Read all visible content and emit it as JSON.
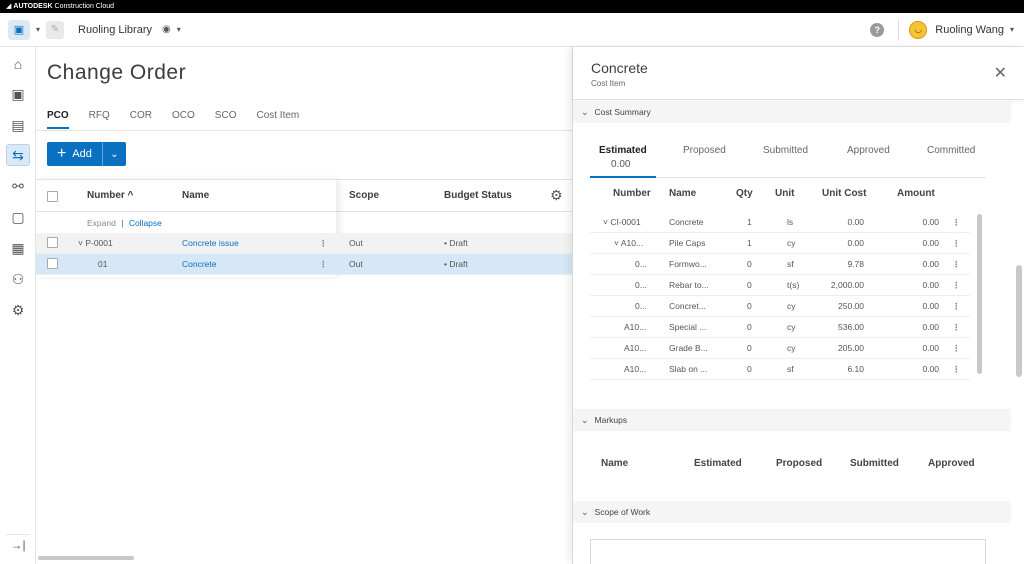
{
  "topbar": {
    "logo_mark": "◢",
    "brand": "AUTODESK",
    "product": "Construction Cloud"
  },
  "header": {
    "library_name": "Ruoling Library",
    "user_name": "Ruoling Wang",
    "help_glyph": "?"
  },
  "icons": {
    "home": "⌂",
    "project": "▣",
    "cost": "▤",
    "change_order": "⇆",
    "binoculars": "⚯",
    "document": "▢",
    "forms": "▦",
    "members": "⚇",
    "settings": "⚙",
    "collapse": "→|",
    "gear": "⚙",
    "close": "✕",
    "chevron_down": "⌄",
    "chevron_down_small": "▾",
    "plus": "+"
  },
  "main": {
    "title": "Change Order",
    "tabs": [
      "PCO",
      "RFQ",
      "COR",
      "OCO",
      "SCO",
      "Cost Item"
    ],
    "active_tab": "PCO",
    "add_label": "Add",
    "columns": {
      "number": "Number ^",
      "name": "Name",
      "scope": "Scope",
      "budget_status": "Budget Status"
    },
    "expand": "Expand",
    "separator": "|",
    "collapse": "Collapse",
    "rows": [
      {
        "number": "˅ P-0001",
        "name": "Concrete issue",
        "scope": "Out",
        "status": "• Draft",
        "menu": "⋮"
      },
      {
        "number": "01",
        "name": "Concrete",
        "scope": "Out",
        "status": "• Draft",
        "menu": "⋮"
      }
    ]
  },
  "panel": {
    "title": "Concrete",
    "subtitle": "Cost Item",
    "sections": {
      "cost_summary": "Cost Summary",
      "markups": "Markups",
      "scope_of_work": "Scope of Work"
    },
    "summary_tabs": [
      "Estimated",
      "Proposed",
      "Submitted",
      "Approved",
      "Committed"
    ],
    "estimated_value": "0.00",
    "cost_columns": {
      "number": "Number",
      "name": "Name",
      "qty": "Qty",
      "unit": "Unit",
      "unit_cost": "Unit Cost",
      "amount": "Amount"
    },
    "cost_rows": [
      {
        "number": "˅ CI-0001",
        "name": "Concrete",
        "qty": "1",
        "unit": "ls",
        "unit_cost": "0.00",
        "amount": "0.00",
        "menu": "⋮"
      },
      {
        "number": "˅ A10...",
        "name": "Pile Caps",
        "qty": "1",
        "unit": "cy",
        "unit_cost": "0.00",
        "amount": "0.00",
        "menu": "⋮"
      },
      {
        "number": "0...",
        "name": "Formwo...",
        "qty": "0",
        "unit": "sf",
        "unit_cost": "9.78",
        "amount": "0.00",
        "menu": "⋮"
      },
      {
        "number": "0...",
        "name": "Rebar to...",
        "qty": "0",
        "unit": "t(s)",
        "unit_cost": "2,000.00",
        "amount": "0.00",
        "menu": "⋮"
      },
      {
        "number": "0...",
        "name": "Concret...",
        "qty": "0",
        "unit": "cy",
        "unit_cost": "250.00",
        "amount": "0.00",
        "menu": "⋮"
      },
      {
        "number": "A10...",
        "name": "Special ...",
        "qty": "0",
        "unit": "cy",
        "unit_cost": "536.00",
        "amount": "0.00",
        "menu": "⋮"
      },
      {
        "number": "A10...",
        "name": "Grade B...",
        "qty": "0",
        "unit": "cy",
        "unit_cost": "205.00",
        "amount": "0.00",
        "menu": "⋮"
      },
      {
        "number": "A10...",
        "name": "Slab on ...",
        "qty": "0",
        "unit": "sf",
        "unit_cost": "6.10",
        "amount": "0.00",
        "menu": "⋮"
      }
    ],
    "markup_columns": [
      "Name",
      "Estimated",
      "Proposed",
      "Submitted",
      "Approved"
    ]
  }
}
